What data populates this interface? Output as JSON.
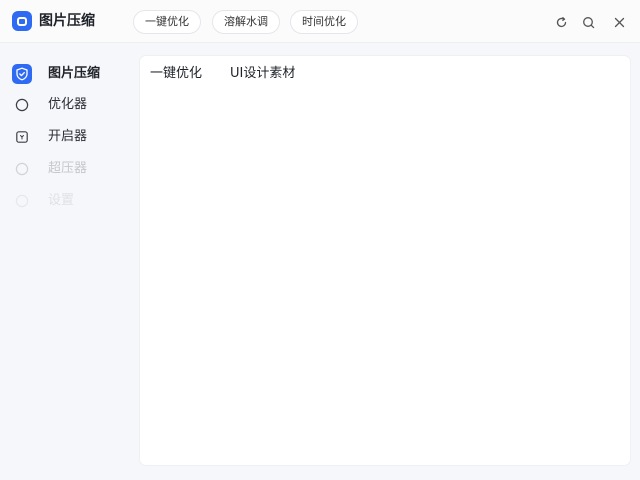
{
  "app": {
    "title": "图片压缩",
    "logo_icon": "app-logo-icon",
    "accent_color": "#2f6bf2"
  },
  "toolbar": {
    "pills": [
      {
        "label": "一键优化"
      },
      {
        "label": "溶解水调"
      },
      {
        "label": "时间优化"
      }
    ],
    "window_controls": [
      {
        "icon": "refresh-icon"
      },
      {
        "icon": "search-icon"
      },
      {
        "icon": "close-icon"
      }
    ]
  },
  "sidebar": {
    "items": [
      {
        "label": "图片压缩",
        "icon": "shield-icon",
        "active": true
      },
      {
        "label": "优化器",
        "icon": "circle-icon"
      },
      {
        "label": "开启器",
        "icon": "file-icon"
      },
      {
        "label": "超压器",
        "icon": "circle-icon"
      },
      {
        "label": "设置",
        "icon": "circle-icon"
      }
    ]
  },
  "main": {
    "tabs": [
      {
        "label": "一键优化"
      },
      {
        "label": "UI设计素材"
      }
    ]
  }
}
